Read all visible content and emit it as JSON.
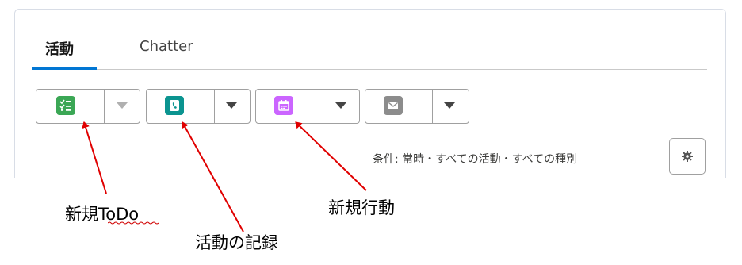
{
  "tabs": {
    "activity": "活動",
    "chatter": "Chatter"
  },
  "action_buttons": [
    {
      "icon": "task-icon",
      "color": "#3ba755"
    },
    {
      "icon": "log-call-icon",
      "color": "#0b9490"
    },
    {
      "icon": "event-icon",
      "color": "#cb65ff"
    },
    {
      "icon": "email-icon",
      "color": "#8c8c8c"
    }
  ],
  "filter": {
    "text": "条件: 常時・すべての活動・すべての種別"
  },
  "annotations": {
    "new_todo": "新規ToDo",
    "log_activity": "活動の記録",
    "new_event": "新規行動"
  },
  "colors": {
    "active_tab": "#0176d3",
    "annotation_arrow": "#e00000"
  }
}
